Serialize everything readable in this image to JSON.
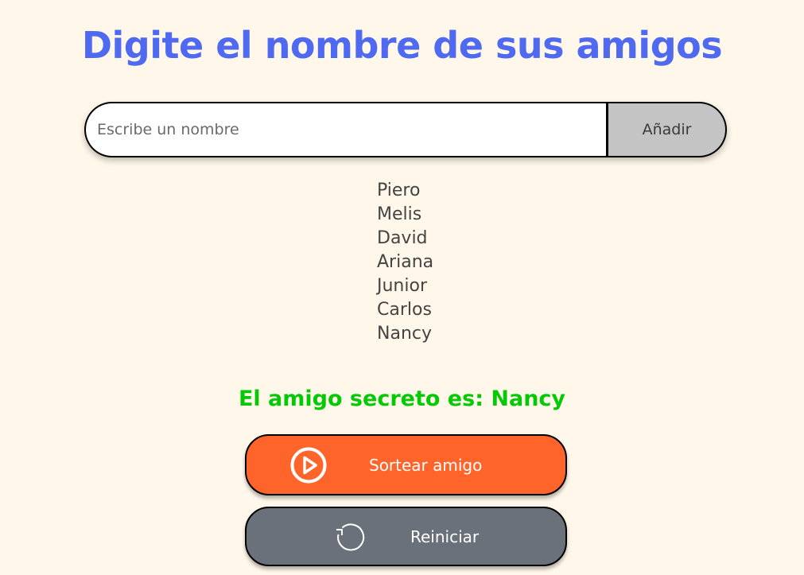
{
  "header": {
    "title": "Digite el nombre de sus amigos"
  },
  "form": {
    "input_placeholder": "Escribe un nombre",
    "input_value": "",
    "add_label": "Añadir"
  },
  "friends": [
    "Piero",
    "Melis",
    "David",
    "Ariana",
    "Junior",
    "Carlos",
    "Nancy"
  ],
  "result": {
    "prefix": "El amigo secreto es: ",
    "winner": "Nancy"
  },
  "actions": {
    "draw_label": "Sortear amigo",
    "draw_icon": "play-circle-icon",
    "reset_label": "Reiniciar",
    "reset_icon": "restart-icon"
  },
  "colors": {
    "background": "#fff8ea",
    "title": "#4f69f0",
    "result": "#05c905",
    "draw_button": "#ff652b",
    "reset_button": "#6b717b",
    "add_button": "#c4c4c4"
  }
}
